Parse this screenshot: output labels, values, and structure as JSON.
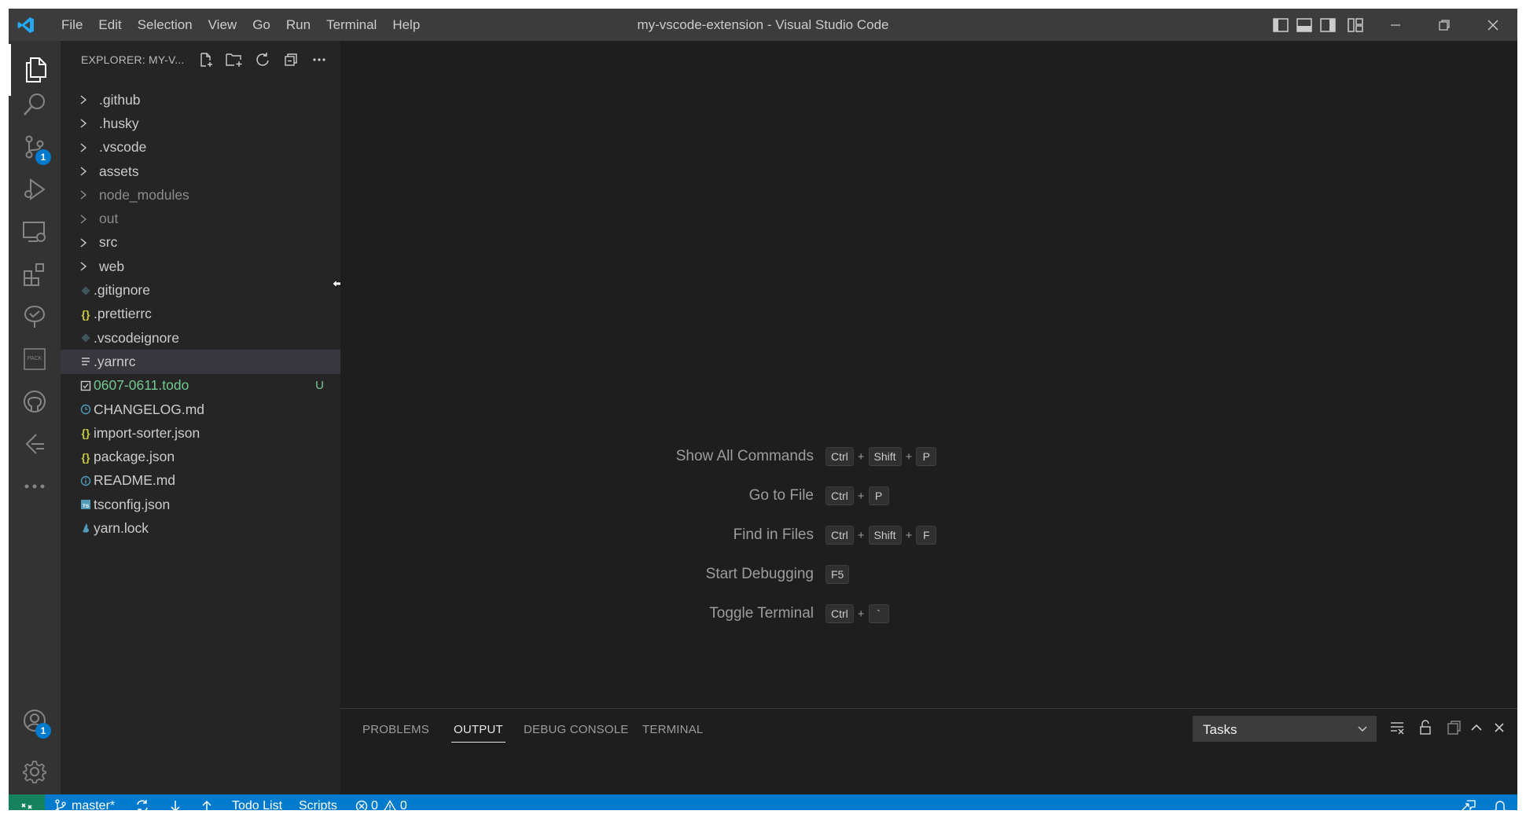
{
  "window": {
    "title": "my-vscode-extension - Visual Studio Code"
  },
  "menu": [
    "File",
    "Edit",
    "Selection",
    "View",
    "Go",
    "Run",
    "Terminal",
    "Help"
  ],
  "activity_bar": {
    "source_control_badge": "1",
    "accounts_badge": "1",
    "items": [
      "explorer-icon",
      "search-icon",
      "source-control-icon",
      "run-debug-icon",
      "remote-explorer-icon",
      "extensions-icon",
      "testing-icon",
      "package-icon",
      "github-icon",
      "timeline-icon",
      "more-icon"
    ]
  },
  "explorer": {
    "title": "EXPLORER: MY-V...",
    "items": [
      {
        "name": ".github",
        "type": "folder"
      },
      {
        "name": ".husky",
        "type": "folder"
      },
      {
        "name": ".vscode",
        "type": "folder"
      },
      {
        "name": "assets",
        "type": "folder"
      },
      {
        "name": "node_modules",
        "type": "folder",
        "dim": true
      },
      {
        "name": "out",
        "type": "folder",
        "dim": true
      },
      {
        "name": "src",
        "type": "folder"
      },
      {
        "name": "web",
        "type": "folder"
      },
      {
        "name": ".gitignore",
        "type": "file",
        "icon": "git-file-icon"
      },
      {
        "name": ".prettierrc",
        "type": "file",
        "icon": "json-braces-icon"
      },
      {
        "name": ".vscodeignore",
        "type": "file",
        "icon": "vscodeignore-file-icon"
      },
      {
        "name": ".yarnrc",
        "type": "file",
        "icon": "lines-file-icon",
        "selected": true
      },
      {
        "name": "0607-0611.todo",
        "type": "file",
        "icon": "todo-checkbox-icon",
        "git": "U"
      },
      {
        "name": "CHANGELOG.md",
        "type": "file",
        "icon": "clock-file-icon"
      },
      {
        "name": "import-sorter.json",
        "type": "file",
        "icon": "json-braces-icon"
      },
      {
        "name": "package.json",
        "type": "file",
        "icon": "json-braces-icon"
      },
      {
        "name": "README.md",
        "type": "file",
        "icon": "info-file-icon"
      },
      {
        "name": "tsconfig.json",
        "type": "file",
        "icon": "ts-file-icon"
      },
      {
        "name": "yarn.lock",
        "type": "file",
        "icon": "yarn-file-icon"
      }
    ]
  },
  "shortcuts": [
    {
      "label": "Show All Commands",
      "keys": [
        "Ctrl",
        "Shift",
        "P"
      ]
    },
    {
      "label": "Go to File",
      "keys": [
        "Ctrl",
        "P"
      ]
    },
    {
      "label": "Find in Files",
      "keys": [
        "Ctrl",
        "Shift",
        "F"
      ]
    },
    {
      "label": "Start Debugging",
      "keys": [
        "F5"
      ]
    },
    {
      "label": "Toggle Terminal",
      "keys": [
        "Ctrl",
        "`"
      ]
    }
  ],
  "panel": {
    "tabs": [
      "PROBLEMS",
      "OUTPUT",
      "DEBUG CONSOLE",
      "TERMINAL"
    ],
    "active_tab": "OUTPUT",
    "output_channel": "Tasks"
  },
  "status_bar": {
    "branch": "master*",
    "todo_list": "Todo List",
    "scripts": "Scripts",
    "errors": "0",
    "warnings": "0"
  },
  "colors": {
    "accent": "#007acc",
    "remote": "#16825d",
    "untracked": "#73c991",
    "json_icon": "#cbcb41"
  }
}
